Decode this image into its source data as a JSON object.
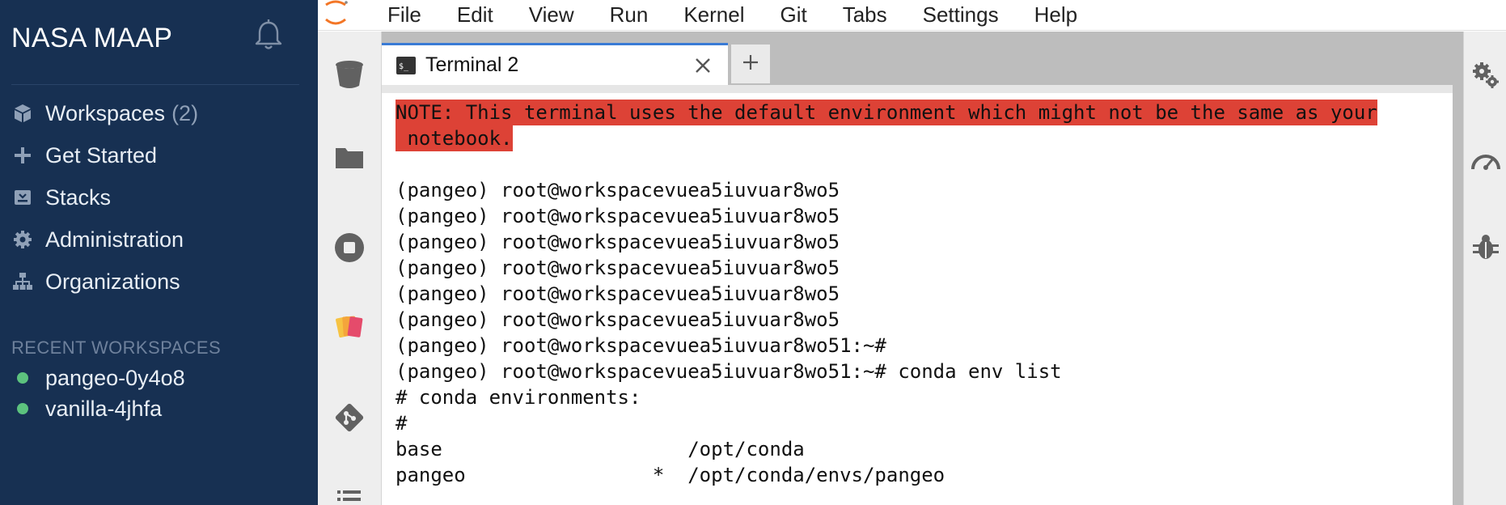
{
  "sidebar": {
    "brand": "NASA MAAP",
    "nav": [
      {
        "label": "Workspaces",
        "count": "(2)",
        "icon": "cube-icon"
      },
      {
        "label": "Get Started",
        "icon": "plus-icon"
      },
      {
        "label": "Stacks",
        "icon": "stack-icon"
      },
      {
        "label": "Administration",
        "icon": "gear-icon"
      },
      {
        "label": "Organizations",
        "icon": "sitemap-icon"
      }
    ],
    "recent_header": "RECENT WORKSPACES",
    "recent": [
      {
        "label": "pangeo-0y4o8",
        "status_color": "#5cc27e"
      },
      {
        "label": "vanilla-4jhfa",
        "status_color": "#5cc27e"
      }
    ]
  },
  "menubar": {
    "items": [
      "File",
      "Edit",
      "View",
      "Run",
      "Kernel",
      "Git",
      "Tabs",
      "Settings",
      "Help"
    ]
  },
  "tab": {
    "label": "Terminal 2",
    "add_label": "+"
  },
  "terminal": {
    "note": [
      "NOTE: This terminal uses the default environment which might not be the same as your",
      " notebook."
    ],
    "lines": [
      "",
      "(pangeo) root@workspacevuea5iuvuar8wo5",
      "(pangeo) root@workspacevuea5iuvuar8wo5",
      "(pangeo) root@workspacevuea5iuvuar8wo5",
      "(pangeo) root@workspacevuea5iuvuar8wo5",
      "(pangeo) root@workspacevuea5iuvuar8wo5",
      "(pangeo) root@workspacevuea5iuvuar8wo5",
      "(pangeo) root@workspacevuea5iuvuar8wo51:~#",
      "(pangeo) root@workspacevuea5iuvuar8wo51:~# conda env list",
      "# conda environments:",
      "#",
      "base                     /opt/conda",
      "pangeo                *  /opt/conda/envs/pangeo"
    ]
  },
  "colors": {
    "sidebar_bg": "#173052",
    "note_bg": "#dd4236",
    "tab_accent": "#3a7bd5",
    "logo_orange": "#f37626"
  }
}
